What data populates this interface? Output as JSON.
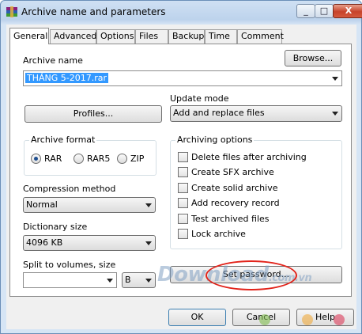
{
  "window": {
    "title": "Archive name and parameters",
    "minimize_glyph": "_",
    "maximize_glyph": "□",
    "close_glyph": "X"
  },
  "tabs": [
    "General",
    "Advanced",
    "Options",
    "Files",
    "Backup",
    "Time",
    "Comment"
  ],
  "active_tab": "General",
  "archive_name": {
    "label": "Archive name",
    "value": "THÁNG 5-2017.rar",
    "browse_label": "Browse..."
  },
  "profiles_label": "Profiles...",
  "update_mode": {
    "label": "Update mode",
    "value": "Add and replace files"
  },
  "archive_format": {
    "title": "Archive format",
    "options": [
      "RAR",
      "RAR5",
      "ZIP"
    ],
    "selected": "RAR"
  },
  "compression_method": {
    "label": "Compression method",
    "value": "Normal"
  },
  "dictionary_size": {
    "label": "Dictionary size",
    "value": "4096 KB"
  },
  "split_volumes": {
    "label": "Split to volumes, size",
    "value": "",
    "unit": "B"
  },
  "archiving_options": {
    "title": "Archiving options",
    "items": [
      {
        "label": "Delete files after archiving",
        "checked": false
      },
      {
        "label": "Create SFX archive",
        "checked": false
      },
      {
        "label": "Create solid archive",
        "checked": false
      },
      {
        "label": "Add recovery record",
        "checked": false
      },
      {
        "label": "Test archived files",
        "checked": false
      },
      {
        "label": "Lock archive",
        "checked": false
      }
    ]
  },
  "set_password_label": "Set password...",
  "buttons": {
    "ok": "OK",
    "cancel": "Cancel",
    "help": "Help"
  },
  "watermark": {
    "main": "Download",
    "suffix": ".com.vn"
  },
  "colors": {
    "selection": "#3399ff",
    "annotation_circle": "#e2231a",
    "title_bar": "#bdd3ec"
  }
}
